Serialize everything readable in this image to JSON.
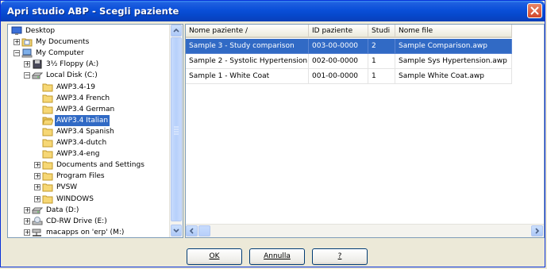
{
  "window": {
    "title": "Apri studio ABP - Scegli paziente"
  },
  "tree": {
    "items": [
      {
        "label": "Desktop",
        "icon": "desktop-icon",
        "indent": 0,
        "expander": ""
      },
      {
        "label": "My Documents",
        "icon": "my-documents-icon",
        "indent": 1,
        "expander": "+"
      },
      {
        "label": "My Computer",
        "icon": "my-computer-icon",
        "indent": 1,
        "expander": "-"
      },
      {
        "label": "3½ Floppy (A:)",
        "icon": "floppy-icon",
        "indent": 2,
        "expander": "+"
      },
      {
        "label": "Local Disk (C:)",
        "icon": "hard-drive-icon",
        "indent": 2,
        "expander": "-"
      },
      {
        "label": "AWP3.4-19",
        "icon": "folder-icon",
        "indent": 3,
        "expander": ""
      },
      {
        "label": "AWP3.4 French",
        "icon": "folder-icon",
        "indent": 3,
        "expander": ""
      },
      {
        "label": "AWP3.4 German",
        "icon": "folder-icon",
        "indent": 3,
        "expander": ""
      },
      {
        "label": "AWP3.4 Italian",
        "icon": "folder-open-icon",
        "indent": 3,
        "expander": "",
        "selected": true
      },
      {
        "label": "AWP3.4 Spanish",
        "icon": "folder-icon",
        "indent": 3,
        "expander": ""
      },
      {
        "label": "AWP3.4-dutch",
        "icon": "folder-icon",
        "indent": 3,
        "expander": ""
      },
      {
        "label": "AWP3.4-eng",
        "icon": "folder-icon",
        "indent": 3,
        "expander": ""
      },
      {
        "label": "Documents and Settings",
        "icon": "folder-icon",
        "indent": 3,
        "expander": "+"
      },
      {
        "label": "Program Files",
        "icon": "folder-icon",
        "indent": 3,
        "expander": "+"
      },
      {
        "label": "PVSW",
        "icon": "folder-icon",
        "indent": 3,
        "expander": "+"
      },
      {
        "label": "WINDOWS",
        "icon": "folder-icon",
        "indent": 3,
        "expander": "+"
      },
      {
        "label": "Data (D:)",
        "icon": "hard-drive-icon",
        "indent": 2,
        "expander": "+"
      },
      {
        "label": "CD-RW Drive (E:)",
        "icon": "cd-drive-icon",
        "indent": 2,
        "expander": "+"
      },
      {
        "label": "macapps on 'erp' (M:)",
        "icon": "network-drive-icon",
        "indent": 2,
        "expander": "+"
      }
    ]
  },
  "patients": {
    "columns": [
      "Nome paziente /",
      "ID paziente",
      "Studi",
      "Nome file"
    ],
    "rows": [
      {
        "cells": [
          "Sample 3 - Study comparison",
          "003-00-0000",
          "2",
          "Sample Comparison.awp"
        ],
        "selected": true
      },
      {
        "cells": [
          "Sample 2 - Systolic Hypertension",
          "002-00-0000",
          "1",
          "Sample Sys Hypertension.awp"
        ],
        "selected": false
      },
      {
        "cells": [
          "Sample 1 - White Coat",
          "001-00-0000",
          "1",
          "Sample White Coat.awp"
        ],
        "selected": false
      }
    ]
  },
  "buttons": {
    "ok": "OK",
    "cancel": "Annulla",
    "help": "?"
  },
  "colors": {
    "title_bar": "#0a4fd8",
    "selection": "#316ac5",
    "close_button": "#d2472a"
  }
}
